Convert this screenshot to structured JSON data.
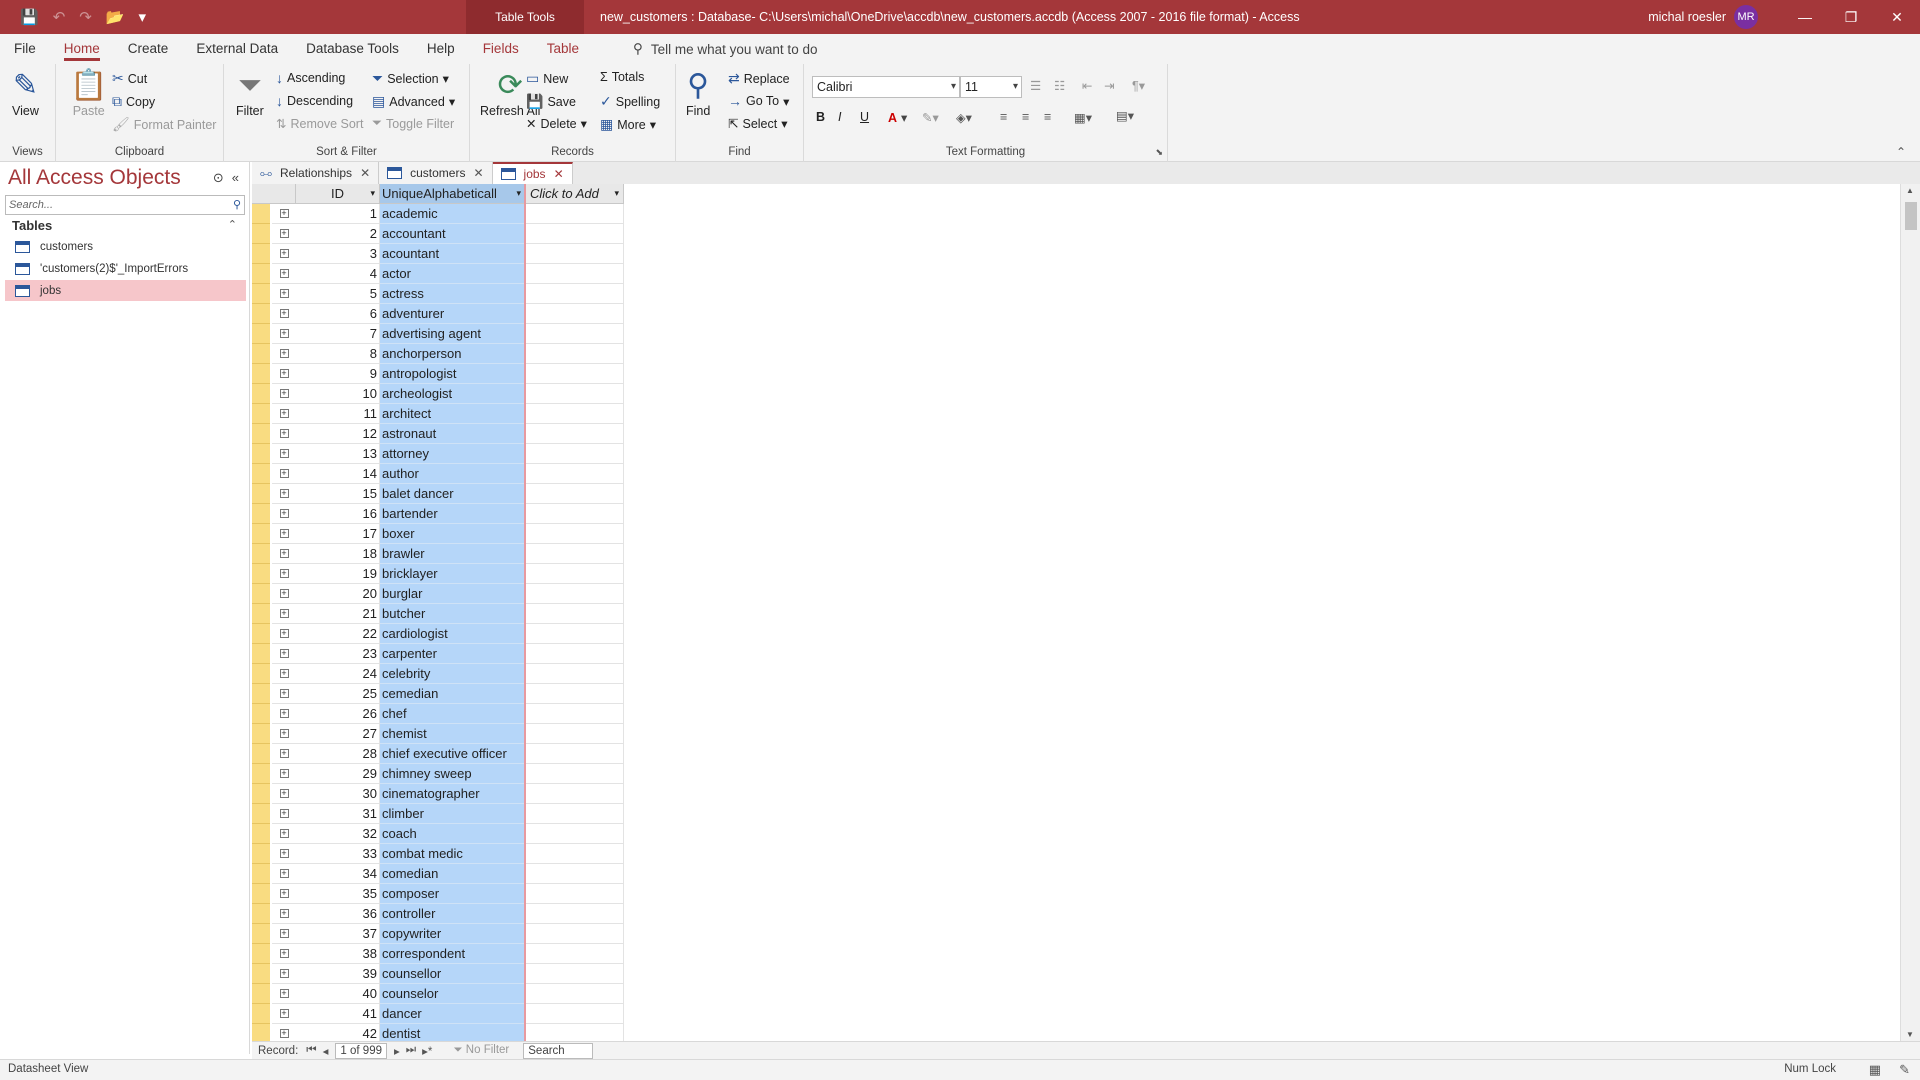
{
  "titlebar": {
    "context_tab": "Table Tools",
    "window_title": "new_customers : Database- C:\\Users\\michal\\OneDrive\\accdb\\new_customers.accdb (Access 2007 - 2016 file format)  -  Access",
    "user_name": "michal roesler",
    "user_initials": "MR"
  },
  "ribbon_tabs": [
    "File",
    "Home",
    "Create",
    "External Data",
    "Database Tools",
    "Help",
    "Fields",
    "Table"
  ],
  "tell_me": "Tell me what you want to do",
  "groups": {
    "views": {
      "label": "Views",
      "view": "View"
    },
    "clipboard": {
      "label": "Clipboard",
      "paste": "Paste",
      "cut": "Cut",
      "copy": "Copy",
      "format_painter": "Format Painter"
    },
    "sort_filter": {
      "label": "Sort & Filter",
      "filter": "Filter",
      "ascending": "Ascending",
      "descending": "Descending",
      "remove_sort": "Remove Sort",
      "selection": "Selection",
      "advanced": "Advanced",
      "toggle_filter": "Toggle Filter"
    },
    "records": {
      "label": "Records",
      "refresh_all": "Refresh All",
      "new": "New",
      "save": "Save",
      "delete": "Delete",
      "totals": "Totals",
      "spelling": "Spelling",
      "more": "More"
    },
    "find": {
      "label": "Find",
      "find": "Find",
      "replace": "Replace",
      "go_to": "Go To",
      "select": "Select"
    },
    "text_formatting": {
      "label": "Text Formatting",
      "font": "Calibri",
      "size": "11",
      "bold": "B",
      "italic": "I",
      "underline": "U",
      "font_color": "A"
    }
  },
  "nav": {
    "title": "All Access Objects",
    "search_placeholder": "Search...",
    "section": "Tables",
    "items": [
      "customers",
      "'customers(2)$'_ImportErrors",
      "jobs"
    ]
  },
  "doc_tabs": [
    "Relationships",
    "customers",
    "jobs"
  ],
  "columns": {
    "id": "ID",
    "job": "UniqueAlphabeticall",
    "add": "Click to Add"
  },
  "rows": [
    [
      1,
      "academic"
    ],
    [
      2,
      "accountant"
    ],
    [
      3,
      "acountant"
    ],
    [
      4,
      "actor"
    ],
    [
      5,
      "actress"
    ],
    [
      6,
      "adventurer"
    ],
    [
      7,
      "advertising agent"
    ],
    [
      8,
      "anchorperson"
    ],
    [
      9,
      "antropologist"
    ],
    [
      10,
      "archeologist"
    ],
    [
      11,
      "architect"
    ],
    [
      12,
      "astronaut"
    ],
    [
      13,
      "attorney"
    ],
    [
      14,
      "author"
    ],
    [
      15,
      "balet dancer"
    ],
    [
      16,
      "bartender"
    ],
    [
      17,
      "boxer"
    ],
    [
      18,
      "brawler"
    ],
    [
      19,
      "bricklayer"
    ],
    [
      20,
      "burglar"
    ],
    [
      21,
      "butcher"
    ],
    [
      22,
      "cardiologist"
    ],
    [
      23,
      "carpenter"
    ],
    [
      24,
      "celebrity"
    ],
    [
      25,
      "cemedian"
    ],
    [
      26,
      "chef"
    ],
    [
      27,
      "chemist"
    ],
    [
      28,
      "chief executive officer"
    ],
    [
      29,
      "chimney sweep"
    ],
    [
      30,
      "cinematographer"
    ],
    [
      31,
      "climber"
    ],
    [
      32,
      "coach"
    ],
    [
      33,
      "combat medic"
    ],
    [
      34,
      "comedian"
    ],
    [
      35,
      "composer"
    ],
    [
      36,
      "controller"
    ],
    [
      37,
      "copywriter"
    ],
    [
      38,
      "correspondent"
    ],
    [
      39,
      "counsellor"
    ],
    [
      40,
      "counselor"
    ],
    [
      41,
      "dancer"
    ],
    [
      42,
      "dentist"
    ]
  ],
  "record_nav": {
    "label": "Record:",
    "position": "1 of 999",
    "no_filter": "No Filter",
    "search": "Search"
  },
  "status": {
    "left": "Datasheet View",
    "num_lock": "Num Lock"
  }
}
